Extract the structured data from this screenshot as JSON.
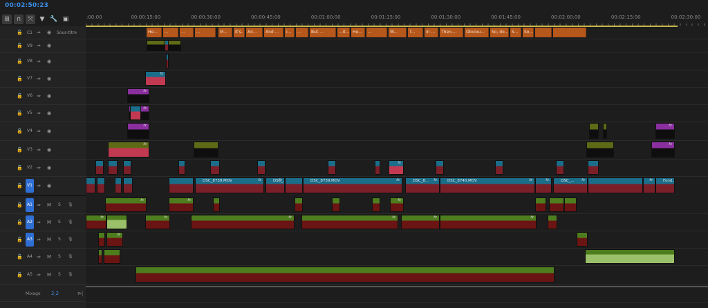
{
  "timecode": "00:02:50:23",
  "toolbar": [
    {
      "icon": "insert-icon",
      "glyph": "⊞",
      "active": true
    },
    {
      "icon": "snap-icon",
      "glyph": "∩",
      "active": true
    },
    {
      "icon": "linked-selection-icon",
      "glyph": "⤧",
      "active": true
    },
    {
      "icon": "marker-icon",
      "glyph": "▼",
      "active": false
    },
    {
      "icon": "wrench-icon",
      "glyph": "🔧",
      "active": false
    },
    {
      "icon": "captions-icon",
      "glyph": "▣",
      "active": false
    }
  ],
  "ruler_labels": [
    ":00:00",
    "00:00:15:00",
    "00:00:30:00",
    "00:00:45:00",
    "00:01:00:00",
    "00:01:15:00",
    "00:01:30:00",
    "00:01:45:00",
    "00:02:00:00",
    "00:02:15:00",
    "00:02:30:00"
  ],
  "tracks": [
    {
      "id": "C1",
      "label": "C1",
      "kind": "caption",
      "extra": "Sous-titre"
    },
    {
      "id": "V9",
      "label": "V9",
      "kind": "video"
    },
    {
      "id": "V8",
      "label": "V8",
      "kind": "video"
    },
    {
      "id": "V7",
      "label": "V7",
      "kind": "video"
    },
    {
      "id": "V6",
      "label": "V6",
      "kind": "video"
    },
    {
      "id": "V5",
      "label": "V5",
      "kind": "video"
    },
    {
      "id": "V4",
      "label": "V4",
      "kind": "video"
    },
    {
      "id": "V3",
      "label": "V3",
      "kind": "video"
    },
    {
      "id": "V2",
      "label": "V2",
      "kind": "video"
    },
    {
      "id": "V1",
      "label": "V1",
      "kind": "video",
      "target": true
    },
    {
      "id": "A1",
      "label": "A1",
      "kind": "audio",
      "target": true
    },
    {
      "id": "A2",
      "label": "A2",
      "kind": "audio",
      "target": true
    },
    {
      "id": "A3",
      "label": "A3",
      "kind": "audio",
      "target": true
    },
    {
      "id": "A4",
      "label": "A4",
      "kind": "audio"
    },
    {
      "id": "A5",
      "label": "A5",
      "kind": "audio"
    }
  ],
  "audio_buttons": {
    "mute": "M",
    "solo": "S"
  },
  "mix": {
    "label": "Mixage",
    "value": "2,2"
  },
  "captions": [
    "He...",
    "...",
    "...",
    "...",
    "M...",
    "It's...",
    "An...",
    "And ...",
    "i...",
    "...",
    "But ...",
    "...it...",
    "He...",
    "...",
    "W...",
    "T...",
    "in ...",
    "Then,...",
    "Obviou...",
    "So, do...",
    "S...",
    "So..."
  ],
  "clip_names": [
    "DSC_8739.MOV",
    "DSC_...",
    "DSC_8739.MOV",
    "DSC_8...",
    "DSC_8740.MOV",
    "DSC_...",
    "Fond..."
  ],
  "fx_label": "fx",
  "colors": {
    "video": "#1b6e8a",
    "video_body": "#7a1e28",
    "audio": "#4e7d1e",
    "audio_body": "#6b1414",
    "purple": "#8a2f9e",
    "olive": "#5f6a17",
    "pink": "#c23a52",
    "caption": "#b6571b",
    "accent": "#2f6fd3",
    "timecode": "#3a8ee6"
  }
}
